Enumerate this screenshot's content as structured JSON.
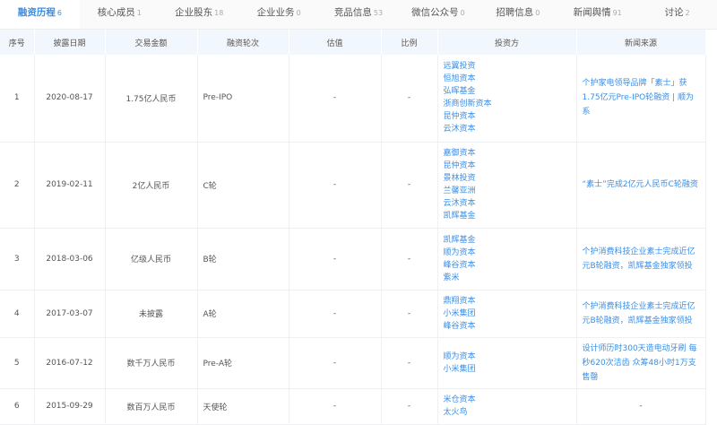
{
  "tabs": [
    {
      "label": "融资历程",
      "count": "6"
    },
    {
      "label": "核心成员",
      "count": "1"
    },
    {
      "label": "企业股东",
      "count": "18"
    },
    {
      "label": "企业业务",
      "count": "0"
    },
    {
      "label": "竞品信息",
      "count": "53"
    },
    {
      "label": "微信公众号",
      "count": "0"
    },
    {
      "label": "招聘信息",
      "count": "0"
    },
    {
      "label": "新闻舆情",
      "count": "91"
    },
    {
      "label": "讨论",
      "count": "2"
    }
  ],
  "columns": [
    "序号",
    "披露日期",
    "交易金额",
    "融资轮次",
    "估值",
    "比例",
    "投资方",
    "新闻来源"
  ],
  "rows": [
    {
      "no": "1",
      "date": "2020-08-17",
      "amount": "1.75亿人民币",
      "round": "Pre-IPO",
      "valuation": "-",
      "ratio": "-",
      "investors": [
        "远翼投资",
        "恒旭资本",
        "弘晖基金",
        "浙商创新资本",
        "昆仲资本",
        "云沐资本"
      ],
      "news": "个护家电领导品牌「素士」获1.75亿元Pre-IPO轮融资 | 顺为系"
    },
    {
      "no": "2",
      "date": "2019-02-11",
      "amount": "2亿人民币",
      "round": "C轮",
      "valuation": "-",
      "ratio": "-",
      "investors": [
        "嘉御资本",
        "昆仲资本",
        "景林投资",
        "兰馨亚洲",
        "云沐资本",
        "凯辉基金"
      ],
      "news": "“素士”完成2亿元人民币C轮融资"
    },
    {
      "no": "3",
      "date": "2018-03-06",
      "amount": "亿级人民币",
      "round": "B轮",
      "valuation": "-",
      "ratio": "-",
      "investors": [
        "凯辉基金",
        "顺为资本",
        "峰谷资本",
        "紫米"
      ],
      "news": "个护消费科技企业素士完成近亿元B轮融资，凯辉基金独家领投"
    },
    {
      "no": "4",
      "date": "2017-03-07",
      "amount": "未披露",
      "round": "A轮",
      "valuation": "-",
      "ratio": "-",
      "investors": [
        "鼎翔资本",
        "小米集团",
        "峰谷资本"
      ],
      "news": "个护消费科技企业素士完成近亿元B轮融资，凯辉基金独家领投"
    },
    {
      "no": "5",
      "date": "2016-07-12",
      "amount": "数千万人民币",
      "round": "Pre-A轮",
      "valuation": "-",
      "ratio": "-",
      "investors": [
        "顺为资本",
        "小米集团"
      ],
      "news": "设计师历时300天造电动牙刷 每秒620次洁齿 众筹48小时1万支售罄"
    },
    {
      "no": "6",
      "date": "2015-09-29",
      "amount": "数百万人民币",
      "round": "天使轮",
      "valuation": "-",
      "ratio": "-",
      "investors": [
        "米仓资本",
        "太火鸟"
      ],
      "news": "-"
    }
  ]
}
